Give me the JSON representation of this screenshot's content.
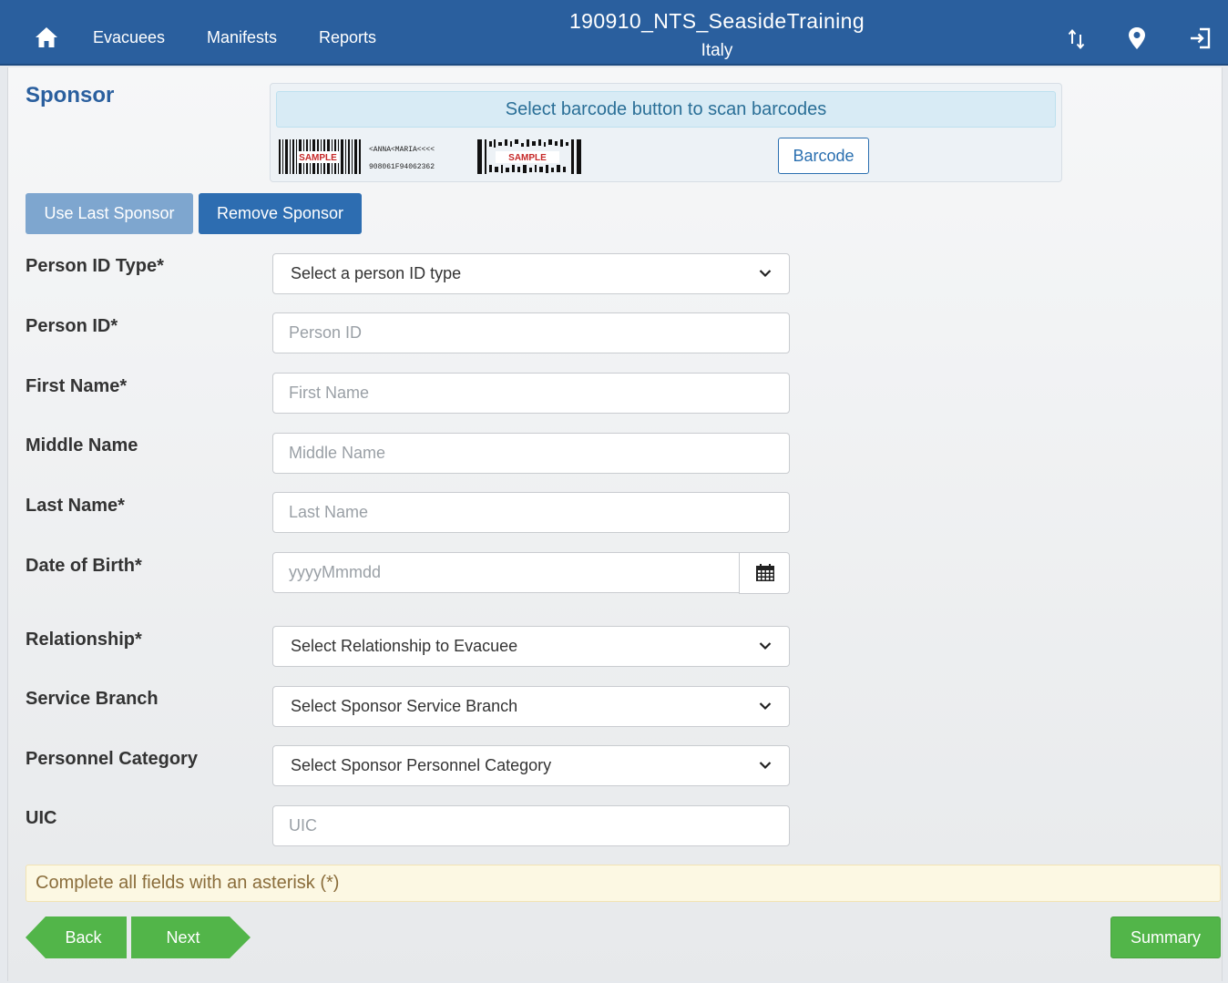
{
  "nav": {
    "links": [
      "Evacuees",
      "Manifests",
      "Reports"
    ],
    "title": "190910_NTS_SeasideTraining",
    "subtitle": "Italy",
    "icons": [
      "home-icon",
      "sync-icon",
      "location-pin-icon",
      "logout-icon"
    ]
  },
  "page": {
    "title": "Sponsor"
  },
  "barcode": {
    "info": "Select barcode button to scan barcodes",
    "button": "Barcode",
    "sample_label": "SAMPLE",
    "sample_text_line1": "<ANNA<MARIA<<<<",
    "sample_text_line2": "908061F94062362"
  },
  "actions": {
    "use_last": "Use Last Sponsor",
    "remove": "Remove Sponsor"
  },
  "form": {
    "fields": [
      {
        "label": "Person ID Type*",
        "type": "select",
        "value": "Select a person ID type"
      },
      {
        "label": "Person ID*",
        "type": "input",
        "placeholder": "Person ID"
      },
      {
        "label": "First Name*",
        "type": "input",
        "placeholder": "First Name"
      },
      {
        "label": "Middle Name",
        "type": "input",
        "placeholder": "Middle Name"
      },
      {
        "label": "Last Name*",
        "type": "input",
        "placeholder": "Last Name"
      },
      {
        "label": "Date of Birth*",
        "type": "date",
        "placeholder": "yyyyMmmdd"
      },
      {
        "label": "Relationship*",
        "type": "select",
        "value": "Select Relationship to Evacuee"
      },
      {
        "label": "Service Branch",
        "type": "select",
        "value": "Select Sponsor Service Branch"
      },
      {
        "label": "Personnel Category",
        "type": "select",
        "value": "Select Sponsor Personnel Category"
      },
      {
        "label": "UIC",
        "type": "input",
        "placeholder": "UIC"
      }
    ]
  },
  "alert": "Complete all fields with an asterisk (*)",
  "footer": {
    "back": "Back",
    "next": "Next",
    "summary": "Summary"
  },
  "colors": {
    "navbar": "#2a5f9e",
    "primary": "#2d6db1",
    "success": "#52b549",
    "info_bg": "#d8ebf5",
    "warning_bg": "#fcf8e3"
  }
}
